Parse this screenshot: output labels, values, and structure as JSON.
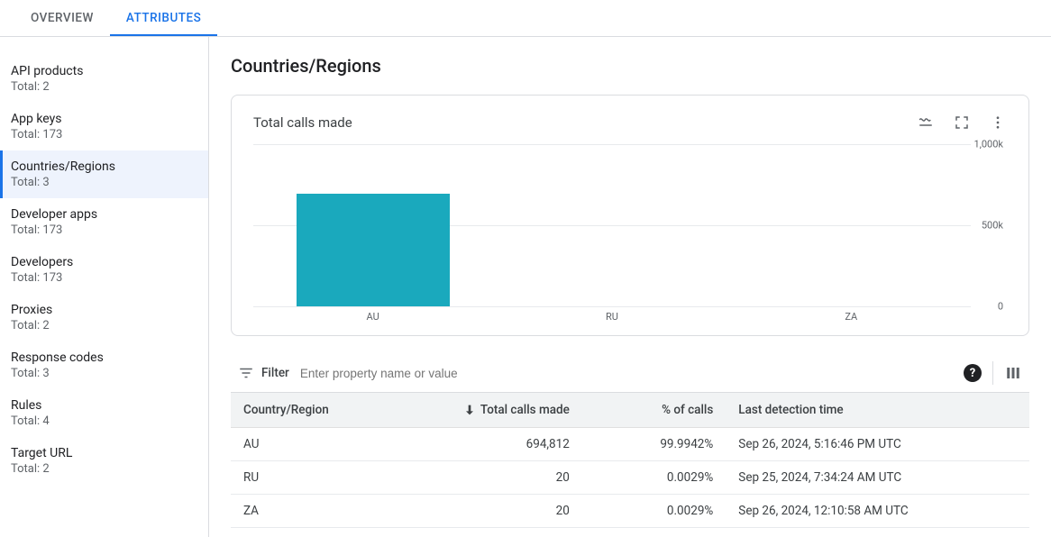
{
  "tabs": [
    {
      "label": "OVERVIEW"
    },
    {
      "label": "ATTRIBUTES"
    }
  ],
  "active_tab": 1,
  "sidebar": {
    "items": [
      {
        "title": "API products",
        "sub": "Total: 2"
      },
      {
        "title": "App keys",
        "sub": "Total: 173"
      },
      {
        "title": "Countries/Regions",
        "sub": "Total: 3"
      },
      {
        "title": "Developer apps",
        "sub": "Total: 173"
      },
      {
        "title": "Developers",
        "sub": "Total: 173"
      },
      {
        "title": "Proxies",
        "sub": "Total: 2"
      },
      {
        "title": "Response codes",
        "sub": "Total: 3"
      },
      {
        "title": "Rules",
        "sub": "Total: 4"
      },
      {
        "title": "Target URL",
        "sub": "Total: 2"
      }
    ],
    "selected": 2
  },
  "page_title": "Countries/Regions",
  "chart": {
    "title": "Total calls made"
  },
  "chart_data": {
    "type": "bar",
    "categories": [
      "AU",
      "RU",
      "ZA"
    ],
    "values": [
      694812,
      20,
      20
    ],
    "title": "Total calls made",
    "xlabel": "",
    "ylabel": "",
    "ylim": [
      0,
      1000000
    ],
    "y_ticks": [
      {
        "v": 0,
        "label": "0"
      },
      {
        "v": 500000,
        "label": "500k"
      },
      {
        "v": 1000000,
        "label": "1,000k"
      }
    ]
  },
  "filter": {
    "label": "Filter",
    "placeholder": "Enter property name or value"
  },
  "table": {
    "columns": [
      "Country/Region",
      "Total calls made",
      "% of calls",
      "Last detection time"
    ],
    "sort_column": 1,
    "rows": [
      {
        "country": "AU",
        "calls": "694,812",
        "pct": "99.9942%",
        "last": "Sep 26, 2024, 5:16:46 PM UTC"
      },
      {
        "country": "RU",
        "calls": "20",
        "pct": "0.0029%",
        "last": "Sep 25, 2024, 7:34:24 AM UTC"
      },
      {
        "country": "ZA",
        "calls": "20",
        "pct": "0.0029%",
        "last": "Sep 26, 2024, 12:10:58 AM UTC"
      }
    ]
  }
}
